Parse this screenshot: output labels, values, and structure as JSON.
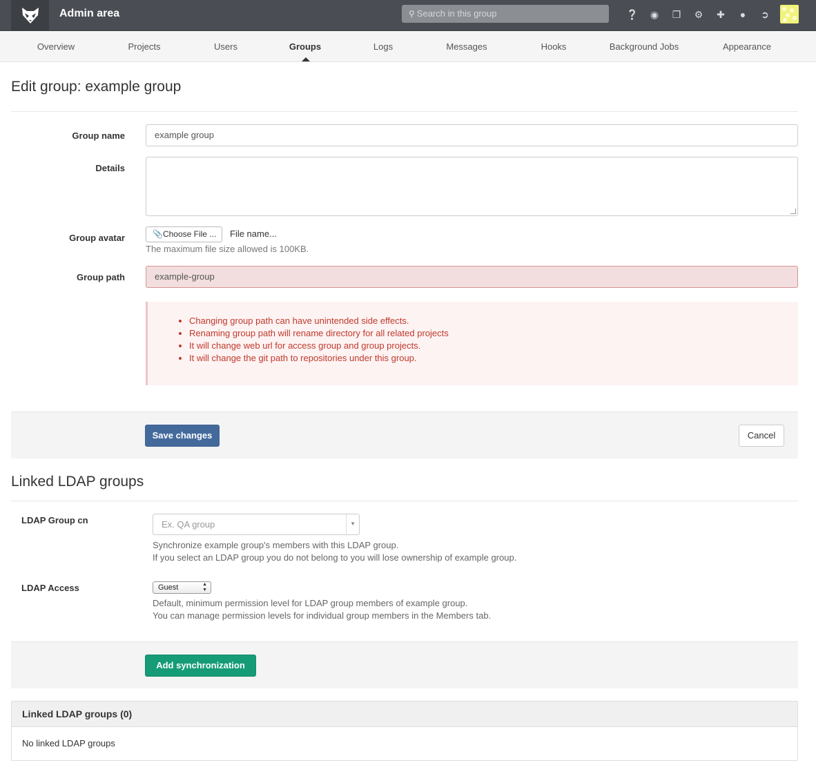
{
  "header": {
    "title": "Admin area",
    "search_placeholder": "Search in this group",
    "icons": [
      "help-icon",
      "globe-icon",
      "copy-icon",
      "gears-icon",
      "plus-icon",
      "user-icon",
      "logout-icon"
    ]
  },
  "nav": {
    "tabs": [
      {
        "label": "Overview"
      },
      {
        "label": "Projects"
      },
      {
        "label": "Users"
      },
      {
        "label": "Groups",
        "active": true
      },
      {
        "label": "Logs"
      },
      {
        "label": "Messages"
      },
      {
        "label": "Hooks"
      },
      {
        "label": "Background Jobs"
      },
      {
        "label": "Appearance"
      }
    ]
  },
  "page": {
    "title": "Edit group: example group"
  },
  "form": {
    "group_name_label": "Group name",
    "group_name_value": "example group",
    "details_label": "Details",
    "details_value": "",
    "avatar_label": "Group avatar",
    "choose_file_label": "Choose File ...",
    "file_name": "File name...",
    "file_help": "The maximum file size allowed is 100KB.",
    "path_label": "Group path",
    "path_value": "example-group",
    "warnings": [
      "Changing group path can have unintended side effects.",
      "Renaming group path will rename directory for all related projects",
      "It will change web url for access group and group projects.",
      "It will change the git path to repositories under this group."
    ],
    "save_label": "Save changes",
    "cancel_label": "Cancel"
  },
  "ldap": {
    "title": "Linked LDAP groups",
    "cn_label": "LDAP Group cn",
    "cn_placeholder": "Ex. QA group",
    "cn_help_1": "Synchronize example group's members with this LDAP group.",
    "cn_help_2": "If you select an LDAP group you do not belong to you will lose ownership of example group.",
    "access_label": "LDAP Access",
    "access_value": "Guest",
    "access_help_1": "Default, minimum permission level for LDAP group members of example group.",
    "access_help_2": "You can manage permission levels for individual group members in the Members tab.",
    "add_label": "Add synchronization",
    "panel_title": "Linked LDAP groups (0)",
    "panel_empty": "No linked LDAP groups"
  },
  "colors": {
    "header_bg": "#4a4e54",
    "primary": "#446a9c",
    "success": "#159c77",
    "error_text": "#c0392b"
  }
}
